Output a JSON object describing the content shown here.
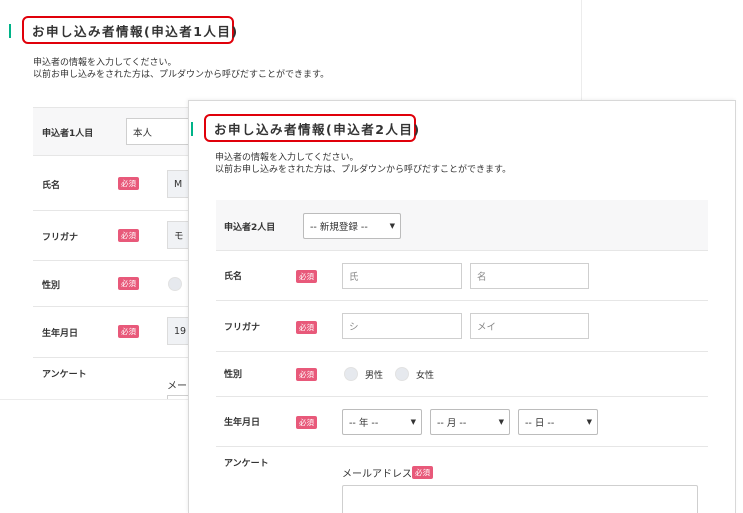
{
  "panel1": {
    "title": "お申し込み者情報(申込者1人目)",
    "desc_line1": "申込者の情報を入力してください。",
    "desc_line2": "以前お申し込みをされた方は、プルダウンから呼びだすことができます。",
    "applicant_label": "申込者1人目",
    "applicant_value": "本人",
    "name_label": "氏名",
    "name_value": "M",
    "furigana_label": "フリガナ",
    "furigana_value": "モ",
    "gender_label": "性別",
    "birth_label": "生年月日",
    "birth_value": "19",
    "survey_label": "アンケート",
    "email_label": "メー",
    "required_badge": "必須"
  },
  "panel2": {
    "title": "お申し込み者情報(申込者2人目)",
    "desc_line1": "申込者の情報を入力してください。",
    "desc_line2": "以前お申し込みをされた方は、プルダウンから呼びだすことができます。",
    "applicant_label": "申込者2人目",
    "applicant_select": "-- 新規登録 --",
    "name_label": "氏名",
    "last_name_placeholder": "氏",
    "first_name_placeholder": "名",
    "furigana_label": "フリガナ",
    "last_kana_placeholder": "シ",
    "first_kana_placeholder": "メイ",
    "gender_label": "性別",
    "male": "男性",
    "female": "女性",
    "birth_label": "生年月日",
    "year_select": "-- 年 --",
    "month_select": "-- 月 --",
    "day_select": "-- 日 --",
    "survey_label": "アンケート",
    "email_label": "メールアドレス",
    "required_badge": "必須"
  },
  "icons": {
    "dropdown": "caret-down-icon"
  },
  "colors": {
    "accent": "#00b388",
    "highlight": "#e0000a",
    "required": "#e8597a"
  }
}
